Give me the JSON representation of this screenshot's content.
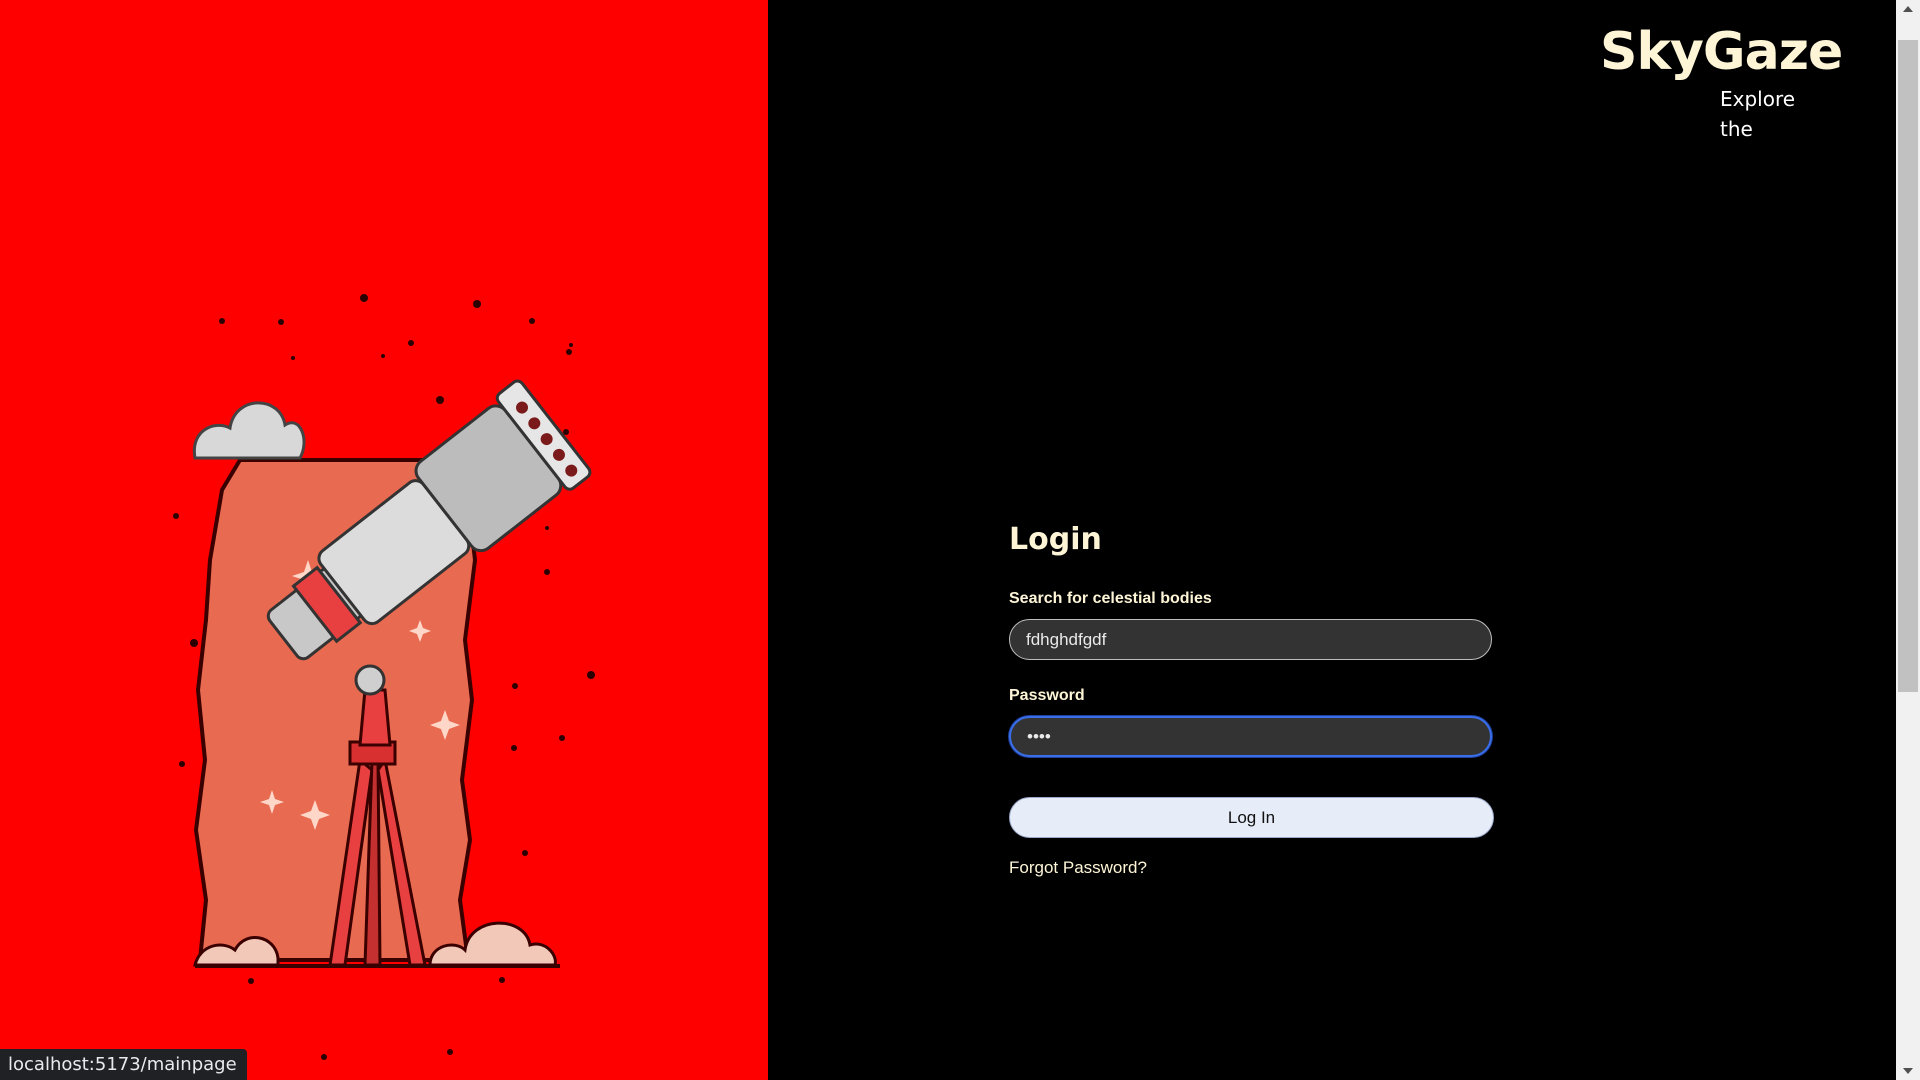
{
  "brand": {
    "name": "SkyGaze",
    "tagline": "Explore the"
  },
  "login": {
    "title": "Login",
    "search_label": "Search for celestial bodies",
    "search_value": "fdhghdfgdf",
    "password_label": "Password",
    "password_value": "••••",
    "login_button": "Log In",
    "forgot_link": "Forgot Password?"
  },
  "status_bar": {
    "url": "localhost:5173/mainpage"
  },
  "colors": {
    "left_panel": "#ff0000",
    "right_panel": "#000000",
    "brand_text": "#fdf5d6",
    "input_bg": "#333333",
    "button_bg": "#e6ecf8",
    "focus_border": "#3a6ee8"
  },
  "illustration": {
    "icon": "telescope-illustration"
  }
}
